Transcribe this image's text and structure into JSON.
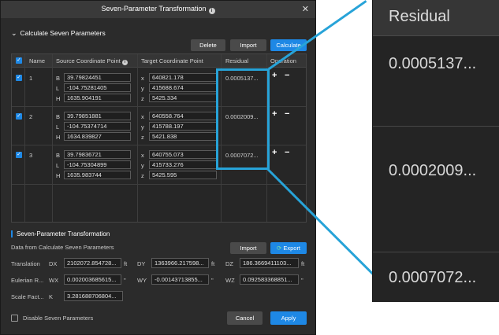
{
  "dialog": {
    "title": "Seven-Parameter Transformation",
    "close_label": "✕"
  },
  "calc_section": {
    "title": "Calculate Seven Parameters",
    "delete_label": "Delete",
    "import_label": "Import",
    "calculate_label": "Calculate"
  },
  "table": {
    "headers": {
      "name": "Name",
      "source": "Source Coordinate Point",
      "target": "Target Coordinate Point",
      "residual": "Residual",
      "operation": "Operation"
    },
    "rows": [
      {
        "name": "1",
        "src_labels": [
          "B",
          "L",
          "H"
        ],
        "src_values": [
          "39.79824451",
          "-104.75281405",
          "1635.904191"
        ],
        "tgt_labels": [
          "x",
          "y",
          "z"
        ],
        "tgt_values": [
          "640821.178",
          "415688.674",
          "5425.334"
        ],
        "residual": "0.0005137..."
      },
      {
        "name": "2",
        "src_labels": [
          "B",
          "L",
          "H"
        ],
        "src_values": [
          "39.79851881",
          "-104.75374714",
          "1634.839827"
        ],
        "tgt_labels": [
          "x",
          "y",
          "z"
        ],
        "tgt_values": [
          "640558.764",
          "415788.197",
          "5421.838"
        ],
        "residual": "0.0002009..."
      },
      {
        "name": "3",
        "src_labels": [
          "B",
          "L",
          "H"
        ],
        "src_values": [
          "39.79836721",
          "-104.75304899",
          "1635.983744"
        ],
        "tgt_labels": [
          "x",
          "y",
          "z"
        ],
        "tgt_values": [
          "640755.073",
          "415733.276",
          "5425.595"
        ],
        "residual": "0.0007072..."
      }
    ],
    "plus_symbol": "+",
    "minus_symbol": "−"
  },
  "transform_section": {
    "title": "Seven-Parameter Transformation",
    "subtitle": "Data from Calculate Seven Parameters",
    "import_label": "Import",
    "export_label": "Export",
    "translation_label": "Translation",
    "dx_label": "DX",
    "dx_value": "2102072.854728...",
    "dy_label": "DY",
    "dy_value": "1363966.217598...",
    "dz_label": "DZ",
    "dz_value": "186.3669411103...",
    "translation_unit": "ft",
    "euler_label": "Eulerian R...",
    "wx_label": "WX",
    "wx_value": "0.002003685615...",
    "wy_label": "WY",
    "wy_value": "-0.00143713855...",
    "wz_label": "WZ",
    "wz_value": "0.092583368851...",
    "rotation_unit": "\"",
    "scale_label": "Scale Fact...",
    "k_label": "K",
    "k_value": "3.281688706804..."
  },
  "footer": {
    "disable_label": "Disable Seven Parameters",
    "cancel_label": "Cancel",
    "apply_label": "Apply"
  },
  "zoom": {
    "header": "Residual",
    "values": [
      "0.0005137...",
      "0.0002009...",
      "0.0007072..."
    ]
  },
  "colors": {
    "accent": "#1e88e5",
    "highlight": "#27a3d8",
    "dialog_bg": "#2b2b2b"
  }
}
